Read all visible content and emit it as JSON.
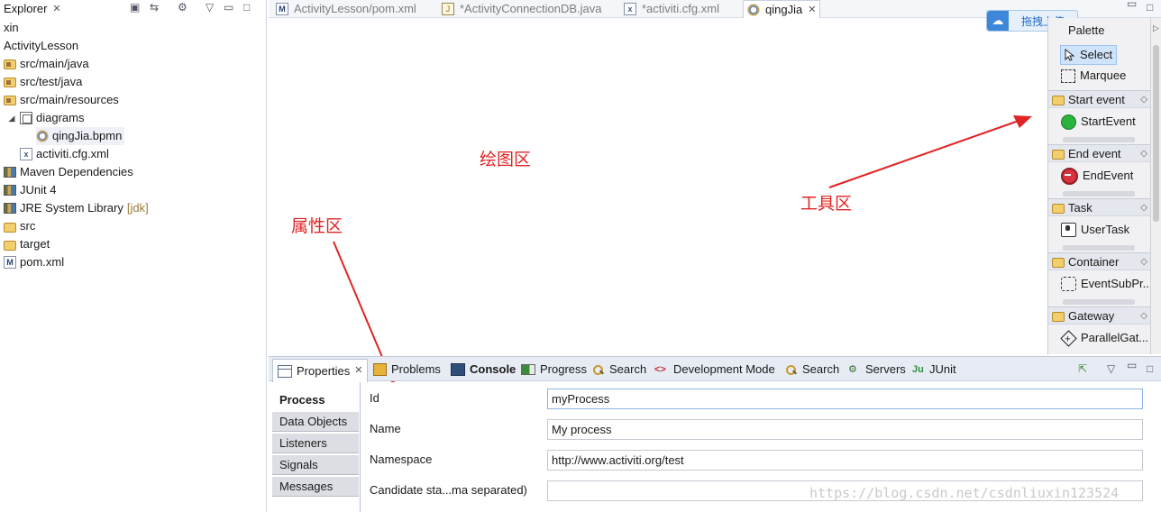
{
  "explorer": {
    "tab_label": "Explorer",
    "close_glyph": "✕",
    "tree": [
      {
        "label": "xin",
        "icon": "",
        "indent": 0
      },
      {
        "label": "ActivityLesson",
        "icon": "",
        "indent": 0
      },
      {
        "label": "src/main/java",
        "icon": "package-folder-icon",
        "indent": 0
      },
      {
        "label": "src/test/java",
        "icon": "package-folder-icon",
        "indent": 0
      },
      {
        "label": "src/main/resources",
        "icon": "package-folder-icon",
        "indent": 0
      },
      {
        "label": "diagrams",
        "icon": "diagrams-folder-icon",
        "indent": 1
      },
      {
        "label": "qingJia.bpmn",
        "icon": "bpmn-file-icon",
        "indent": 2
      },
      {
        "label": "activiti.cfg.xml",
        "icon": "xml-file-icon",
        "indent": 1
      },
      {
        "label": "Maven Dependencies",
        "icon": "library-icon",
        "indent": 0
      },
      {
        "label": "JUnit 4",
        "icon": "library-icon",
        "indent": 0
      },
      {
        "label": "JRE System Library",
        "suffix": "[jdk]",
        "icon": "library-icon",
        "indent": 0
      },
      {
        "label": "src",
        "icon": "folder-icon",
        "indent": 0
      },
      {
        "label": "target",
        "icon": "folder-icon",
        "indent": 0
      },
      {
        "label": "pom.xml",
        "icon": "maven-pom-icon",
        "indent": 0
      }
    ]
  },
  "editor": {
    "tabs": [
      {
        "label": "ActivityLesson/pom.xml",
        "icon": "maven-pom-icon",
        "active": false
      },
      {
        "label": "*ActivityConnectionDB.java",
        "icon": "java-file-icon",
        "active": false
      },
      {
        "label": "*activiti.cfg.xml",
        "icon": "xml-file-icon",
        "active": false
      },
      {
        "label": "qingJia",
        "icon": "bpmn-file-icon",
        "active": true
      }
    ]
  },
  "annotations": {
    "drawing_area": "绘图区",
    "toolbox_area": "工具区",
    "properties_area": "属性区",
    "color": "#e02424"
  },
  "upload": {
    "label": "拖拽上传",
    "icon": "cloud-icon"
  },
  "palette": {
    "title": "Palette",
    "tools": [
      {
        "label": "Select",
        "icon": "select-arrow-icon",
        "selected": true
      },
      {
        "label": "Marquee",
        "icon": "marquee-icon",
        "selected": false
      }
    ],
    "groups": [
      {
        "label": "Start event",
        "item": "StartEvent",
        "icon": "start-event-icon"
      },
      {
        "label": "End event",
        "item": "EndEvent",
        "icon": "end-event-icon"
      },
      {
        "label": "Task",
        "item": "UserTask",
        "icon": "user-task-icon"
      },
      {
        "label": "Container",
        "item": "EventSubPr...",
        "icon": "event-subprocess-icon"
      },
      {
        "label": "Gateway",
        "item": "ParallelGat...",
        "icon": "parallel-gateway-icon"
      }
    ]
  },
  "bottom_tabs": [
    {
      "label": "Properties",
      "icon": "properties-icon",
      "active": true,
      "closable": true
    },
    {
      "label": "Problems",
      "icon": "problems-icon",
      "active": false
    },
    {
      "label": "Console",
      "icon": "console-icon",
      "active": false,
      "bold": true
    },
    {
      "label": "Progress",
      "icon": "progress-icon",
      "active": false
    },
    {
      "label": "Search",
      "icon": "search-icon",
      "active": false
    },
    {
      "label": "Development Mode",
      "icon": "dev-mode-icon",
      "active": false
    },
    {
      "label": "Search",
      "icon": "search-icon",
      "active": false
    },
    {
      "label": "Servers",
      "icon": "servers-icon",
      "active": false
    },
    {
      "label": "JUnit",
      "icon": "junit-icon",
      "active": false
    }
  ],
  "properties": {
    "side_tabs": [
      "Process",
      "Data Objects",
      "Listeners",
      "Signals",
      "Messages"
    ],
    "active_side_tab": "Process",
    "fields": [
      {
        "label": "Id",
        "value": "myProcess"
      },
      {
        "label": "Name",
        "value": "My process"
      },
      {
        "label": "Namespace",
        "value": "http://www.activiti.org/test"
      },
      {
        "label": "Candidate sta...ma separated)",
        "value": ""
      }
    ]
  },
  "watermark": "https://blog.csdn.net/csdnliuxin123524"
}
